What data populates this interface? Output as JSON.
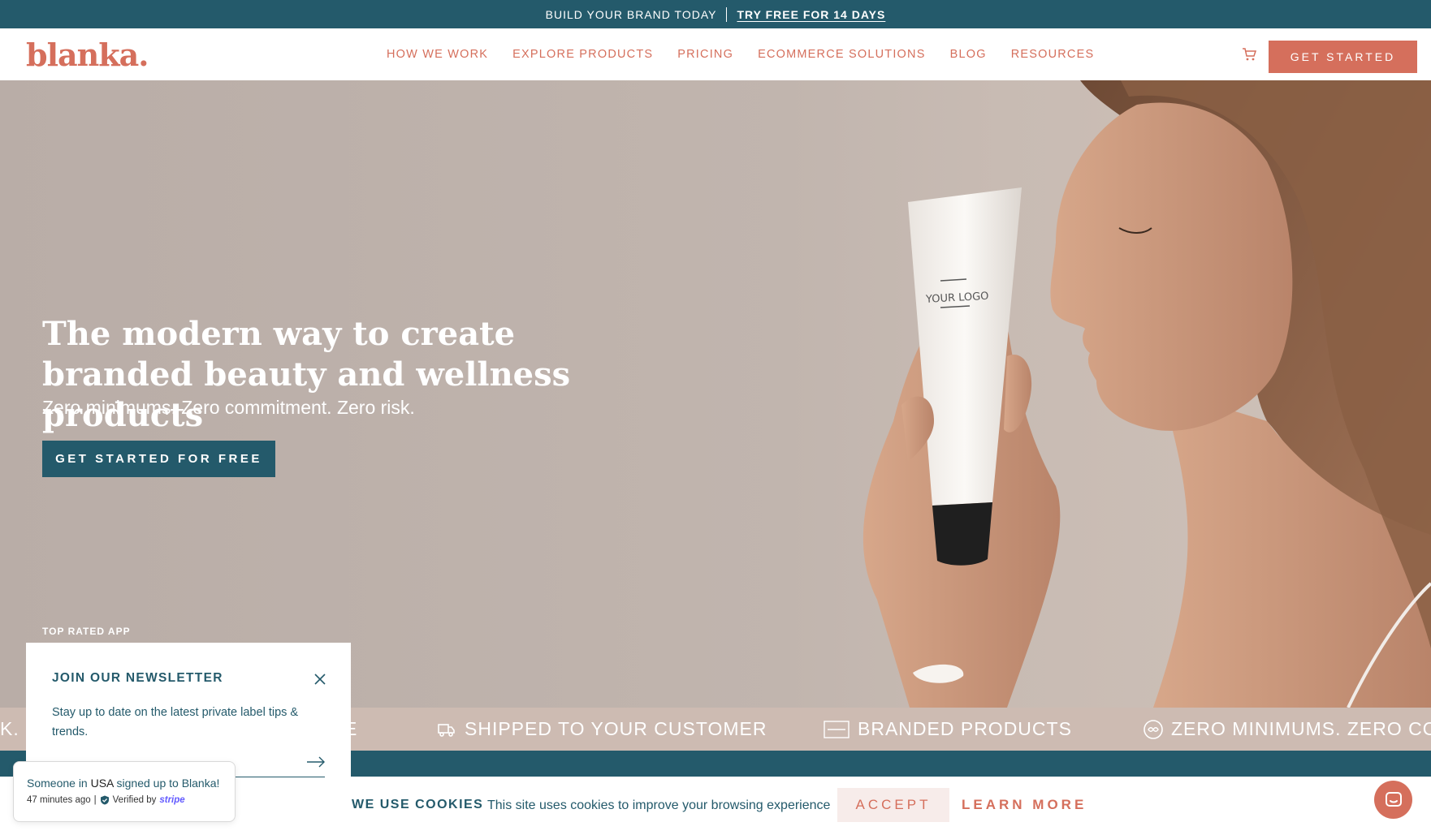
{
  "announcement": {
    "text": "BUILD YOUR BRAND TODAY",
    "link": "TRY FREE FOR 14 DAYS"
  },
  "header": {
    "logo": "blanka.",
    "nav": [
      "HOW WE WORK",
      "EXPLORE PRODUCTS",
      "PRICING",
      "ECOMMERCE SOLUTIONS",
      "BLOG",
      "RESOURCES"
    ],
    "cart_icon": "cart-icon",
    "cta": "GET STARTED"
  },
  "hero": {
    "title": "The modern way to create branded beauty and wellness products",
    "subtitle": "Zero minimums. Zero commitment. Zero risk.",
    "cta": "GET STARTED FOR FREE",
    "rated_label": "TOP RATED APP",
    "product_label": "YOUR LOGO"
  },
  "marquee": {
    "items": [
      {
        "text": "K.",
        "icon": ""
      },
      {
        "text": "E",
        "icon": ""
      },
      {
        "text": "SHIPPED TO YOUR CUSTOMER",
        "icon": "delivery-truck-icon"
      },
      {
        "text": "BRANDED PRODUCTS",
        "icon": "your-logo-icon"
      },
      {
        "text": "ZERO MINIMUMS. ZERO COM",
        "icon": "infinity-icon"
      }
    ]
  },
  "newsletter": {
    "title": "JOIN OUR NEWSLETTER",
    "description": "Stay up to date on the latest private label tips & trends.",
    "email_placeholder": ""
  },
  "toast": {
    "prefix": "Someone in",
    "location": "USA",
    "suffix": "signed up to Blanka!",
    "time": "47 minutes ago",
    "verified": "Verified by",
    "provider": "stripe"
  },
  "cookie": {
    "title": "WE USE COOKIES",
    "text": "This site uses cookies to improve your browsing experience",
    "accept": "ACCEPT",
    "learn_more": "LEARN MORE"
  },
  "colors": {
    "teal": "#245a6b",
    "coral": "#d56f5c",
    "hero_bg": "#c1b5ae"
  }
}
